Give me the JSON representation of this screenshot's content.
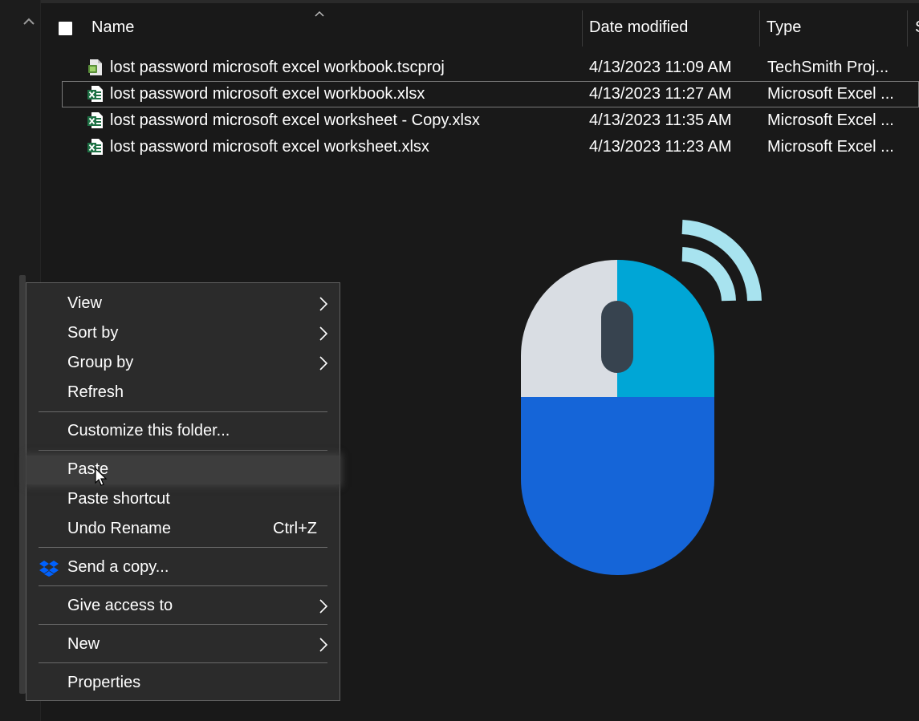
{
  "header": {
    "name_label": "Name",
    "date_label": "Date modified",
    "type_label": "Type",
    "size_label": "S"
  },
  "files": [
    {
      "name": "lost password microsoft excel workbook.tscproj",
      "date": "4/13/2023 11:09 AM",
      "type": "TechSmith Proj...",
      "icon": "techsmith-project-icon"
    },
    {
      "name": "lost password microsoft excel workbook.xlsx",
      "date": "4/13/2023 11:27 AM",
      "type": "Microsoft Excel ...",
      "icon": "excel-file-icon"
    },
    {
      "name": "lost password microsoft excel worksheet - Copy.xlsx",
      "date": "4/13/2023 11:35 AM",
      "type": "Microsoft Excel ...",
      "icon": "excel-file-icon"
    },
    {
      "name": "lost password microsoft excel worksheet.xlsx",
      "date": "4/13/2023 11:23 AM",
      "type": "Microsoft Excel ...",
      "icon": "excel-file-icon"
    }
  ],
  "context_menu": {
    "view": "View",
    "sort_by": "Sort by",
    "group_by": "Group by",
    "refresh": "Refresh",
    "customize": "Customize this folder...",
    "paste": "Paste",
    "paste_shortcut": "Paste shortcut",
    "undo_rename": "Undo Rename",
    "undo_rename_accel": "Ctrl+Z",
    "send_copy": "Send a copy...",
    "give_access": "Give access to",
    "new": "New",
    "properties": "Properties"
  },
  "colors": {
    "background": "#191919",
    "menu_bg": "#2b2b2b",
    "excel_green": "#1e7145",
    "dropbox_blue": "#0061fe",
    "mouse_light": "#d9dde3",
    "mouse_cyan": "#00a6d6",
    "mouse_blue": "#1565d8",
    "wifi_arcs": "#a8e3ef"
  }
}
